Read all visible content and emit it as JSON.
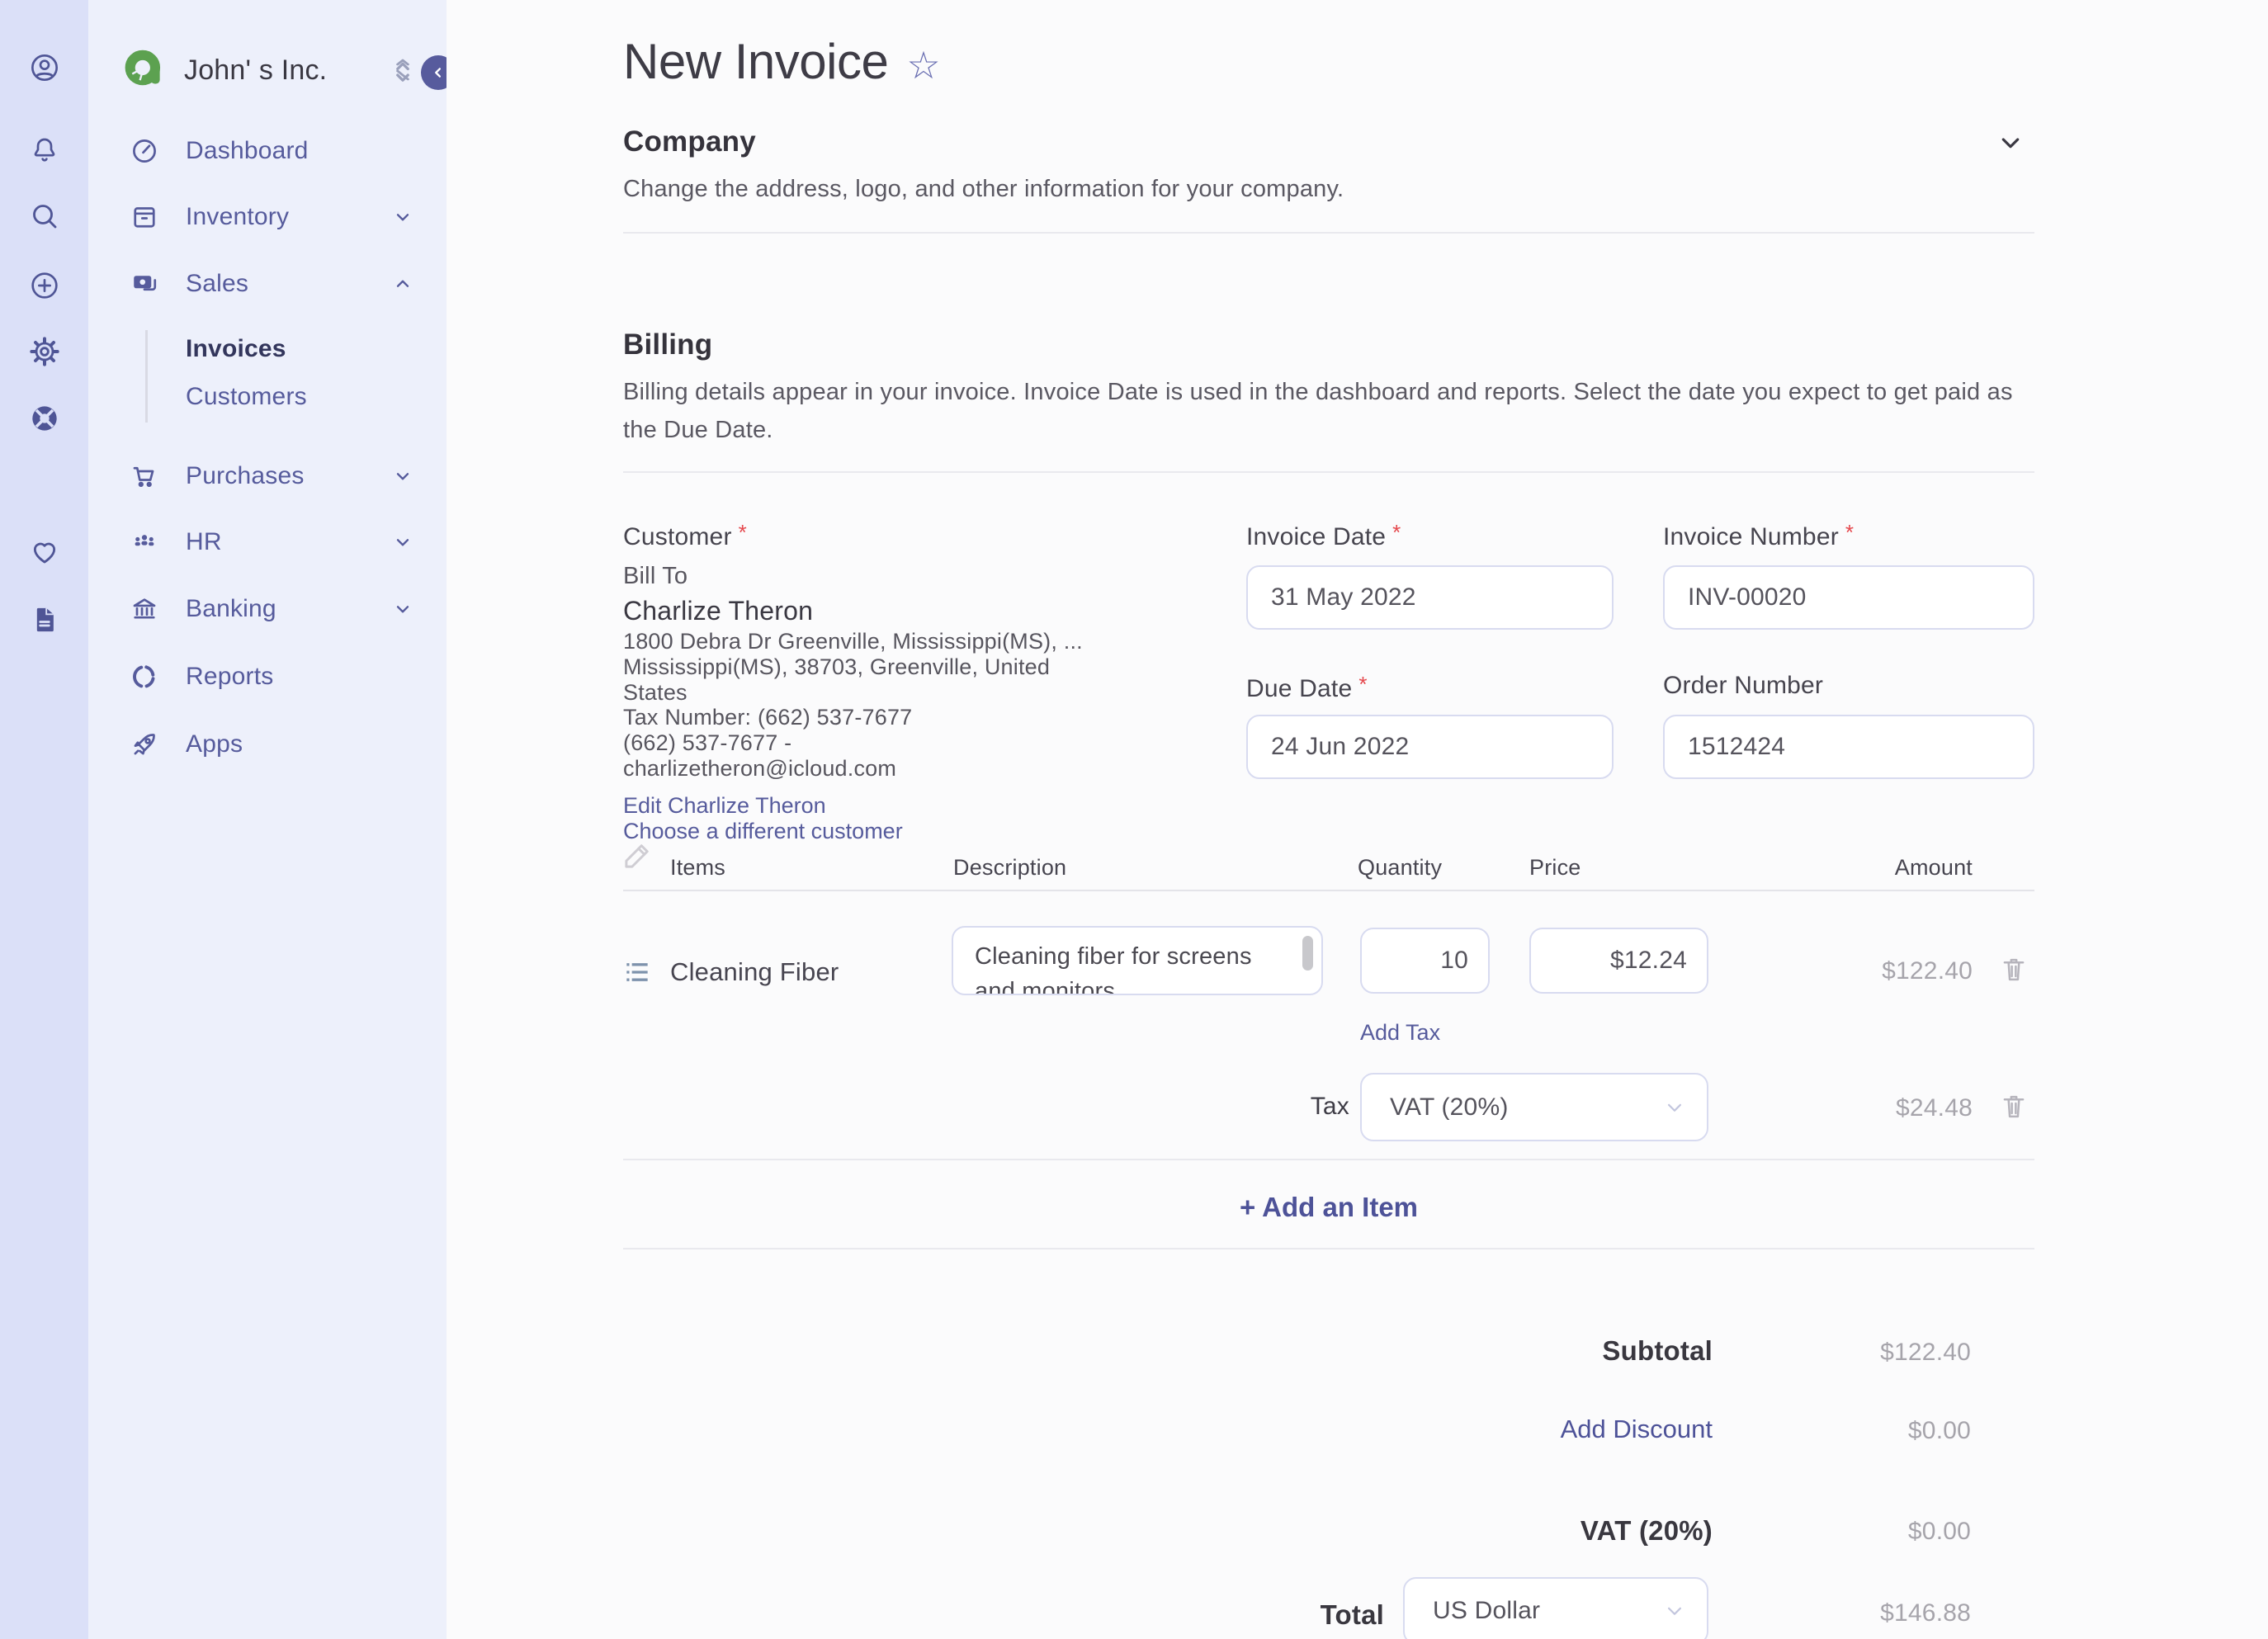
{
  "iconbar": {
    "icons": [
      {
        "name": "account"
      },
      {
        "name": "notifications"
      },
      {
        "name": "search"
      },
      {
        "name": "create-new"
      },
      {
        "name": "settings"
      },
      {
        "name": "support"
      },
      {
        "name": "favorites"
      },
      {
        "name": "documents"
      }
    ]
  },
  "sidebar": {
    "company_name": "John' s Inc.",
    "nav": [
      {
        "label": "Dashboard"
      },
      {
        "label": "Inventory",
        "chevron": "down"
      },
      {
        "label": "Sales",
        "chevron": "up"
      },
      {
        "label": "Purchases",
        "chevron": "down"
      },
      {
        "label": "HR",
        "chevron": "down"
      },
      {
        "label": "Banking",
        "chevron": "down"
      },
      {
        "label": "Reports"
      },
      {
        "label": "Apps"
      }
    ],
    "sales_submenu": [
      {
        "label": "Invoices",
        "active": true
      },
      {
        "label": "Customers",
        "active": false
      }
    ]
  },
  "header": {
    "title": "New Invoice",
    "star_icon": "☆"
  },
  "company_section": {
    "title": "Company",
    "description": "Change the address, logo, and other information for your company."
  },
  "billing_section": {
    "title": "Billing",
    "description": "Billing details appear in your invoice. Invoice Date is used in the dashboard and reports. Select the date you expect to get paid as the Due Date."
  },
  "required_marker": "*",
  "customer": {
    "label": "Customer",
    "bill_to": "Bill To",
    "name": "Charlize Theron",
    "address_line1": "1800 Debra Dr Greenville, Mississippi(MS),  ...",
    "address_line2": "Mississippi(MS), 38703, Greenville, United",
    "address_line3": "States",
    "tax_number": "Tax Number: (662) 537-7677",
    "phone": "(662) 537-7677   -",
    "email": "charlizetheron@icloud.com",
    "edit_link": "Edit Charlize Theron",
    "choose_link": "Choose a different customer"
  },
  "fields": {
    "invoice_date": {
      "label": "Invoice Date",
      "value": "31 May 2022"
    },
    "invoice_number": {
      "label": "Invoice Number",
      "value": "INV-00020"
    },
    "due_date": {
      "label": "Due Date",
      "value": "24 Jun 2022"
    },
    "order_number": {
      "label": "Order Number",
      "value": "1512424"
    }
  },
  "items_table": {
    "headers": {
      "items": "Items",
      "description": "Description",
      "quantity": "Quantity",
      "price": "Price",
      "amount": "Amount"
    },
    "row": {
      "name": "Cleaning Fiber",
      "description": "Cleaning fiber for screens and monitors",
      "quantity": "10",
      "price": "$12.24",
      "amount": "$122.40"
    },
    "add_tax_label": "Add Tax",
    "tax_row": {
      "label": "Tax",
      "value": "VAT (20%)",
      "amount": "$24.48"
    },
    "add_item_label": "+ Add an Item"
  },
  "totals": {
    "rows": [
      {
        "label": "Subtotal",
        "value": "$122.40"
      },
      {
        "label": "Add Discount",
        "value": "$0.00"
      },
      {
        "label": "VAT (20%)",
        "value": "$0.00"
      }
    ],
    "total": {
      "label": "Total",
      "currency": "US Dollar",
      "value": "$146.88"
    }
  },
  "colors": {
    "accent": "#565b9c",
    "iconbar_bg": "#dbe0f8",
    "sidebar_bg": "#edf0fb",
    "main_bg": "#fbfbfc",
    "link": "#4d5298",
    "muted_amount": "#a6a4ab",
    "required": "#e5484d",
    "logo_green": "#5ca150",
    "collapse_btn": "#575b9d"
  }
}
